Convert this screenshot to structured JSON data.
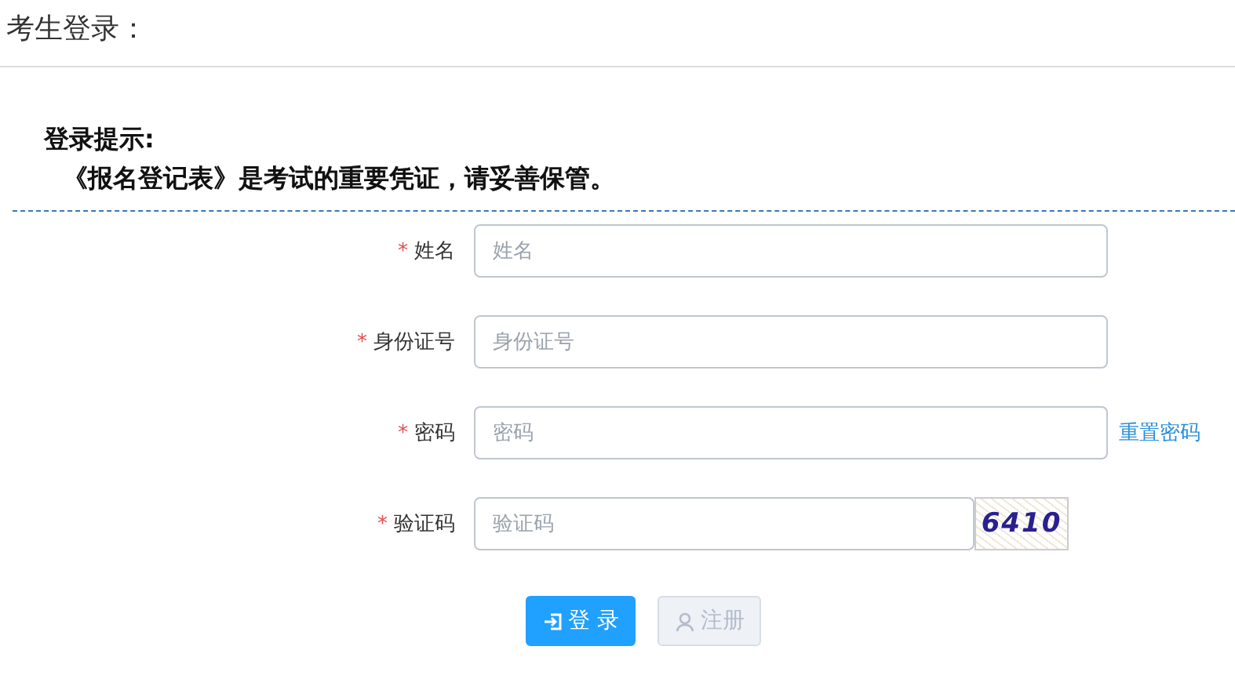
{
  "page_title": "考生登录：",
  "notice": {
    "heading": "登录提示:",
    "text": "《报名登记表》是考试的重要凭证，请妥善保管。"
  },
  "fields": [
    {
      "kind": "plain",
      "required_mark": "*",
      "label": "姓名",
      "placeholder": "姓名"
    },
    {
      "kind": "plain",
      "required_mark": "*",
      "label": "身份证号",
      "placeholder": "身份证号"
    },
    {
      "kind": "link",
      "required_mark": "*",
      "label": "密码",
      "placeholder": "密码",
      "link": "重置密码"
    },
    {
      "kind": "captcha",
      "required_mark": "*",
      "label": "验证码",
      "placeholder": "验证码",
      "captcha": "6410"
    }
  ],
  "buttons": [
    {
      "kind": "login",
      "label": "登 录",
      "disabled": false
    },
    {
      "kind": "register",
      "label": "注册",
      "disabled": true
    }
  ]
}
